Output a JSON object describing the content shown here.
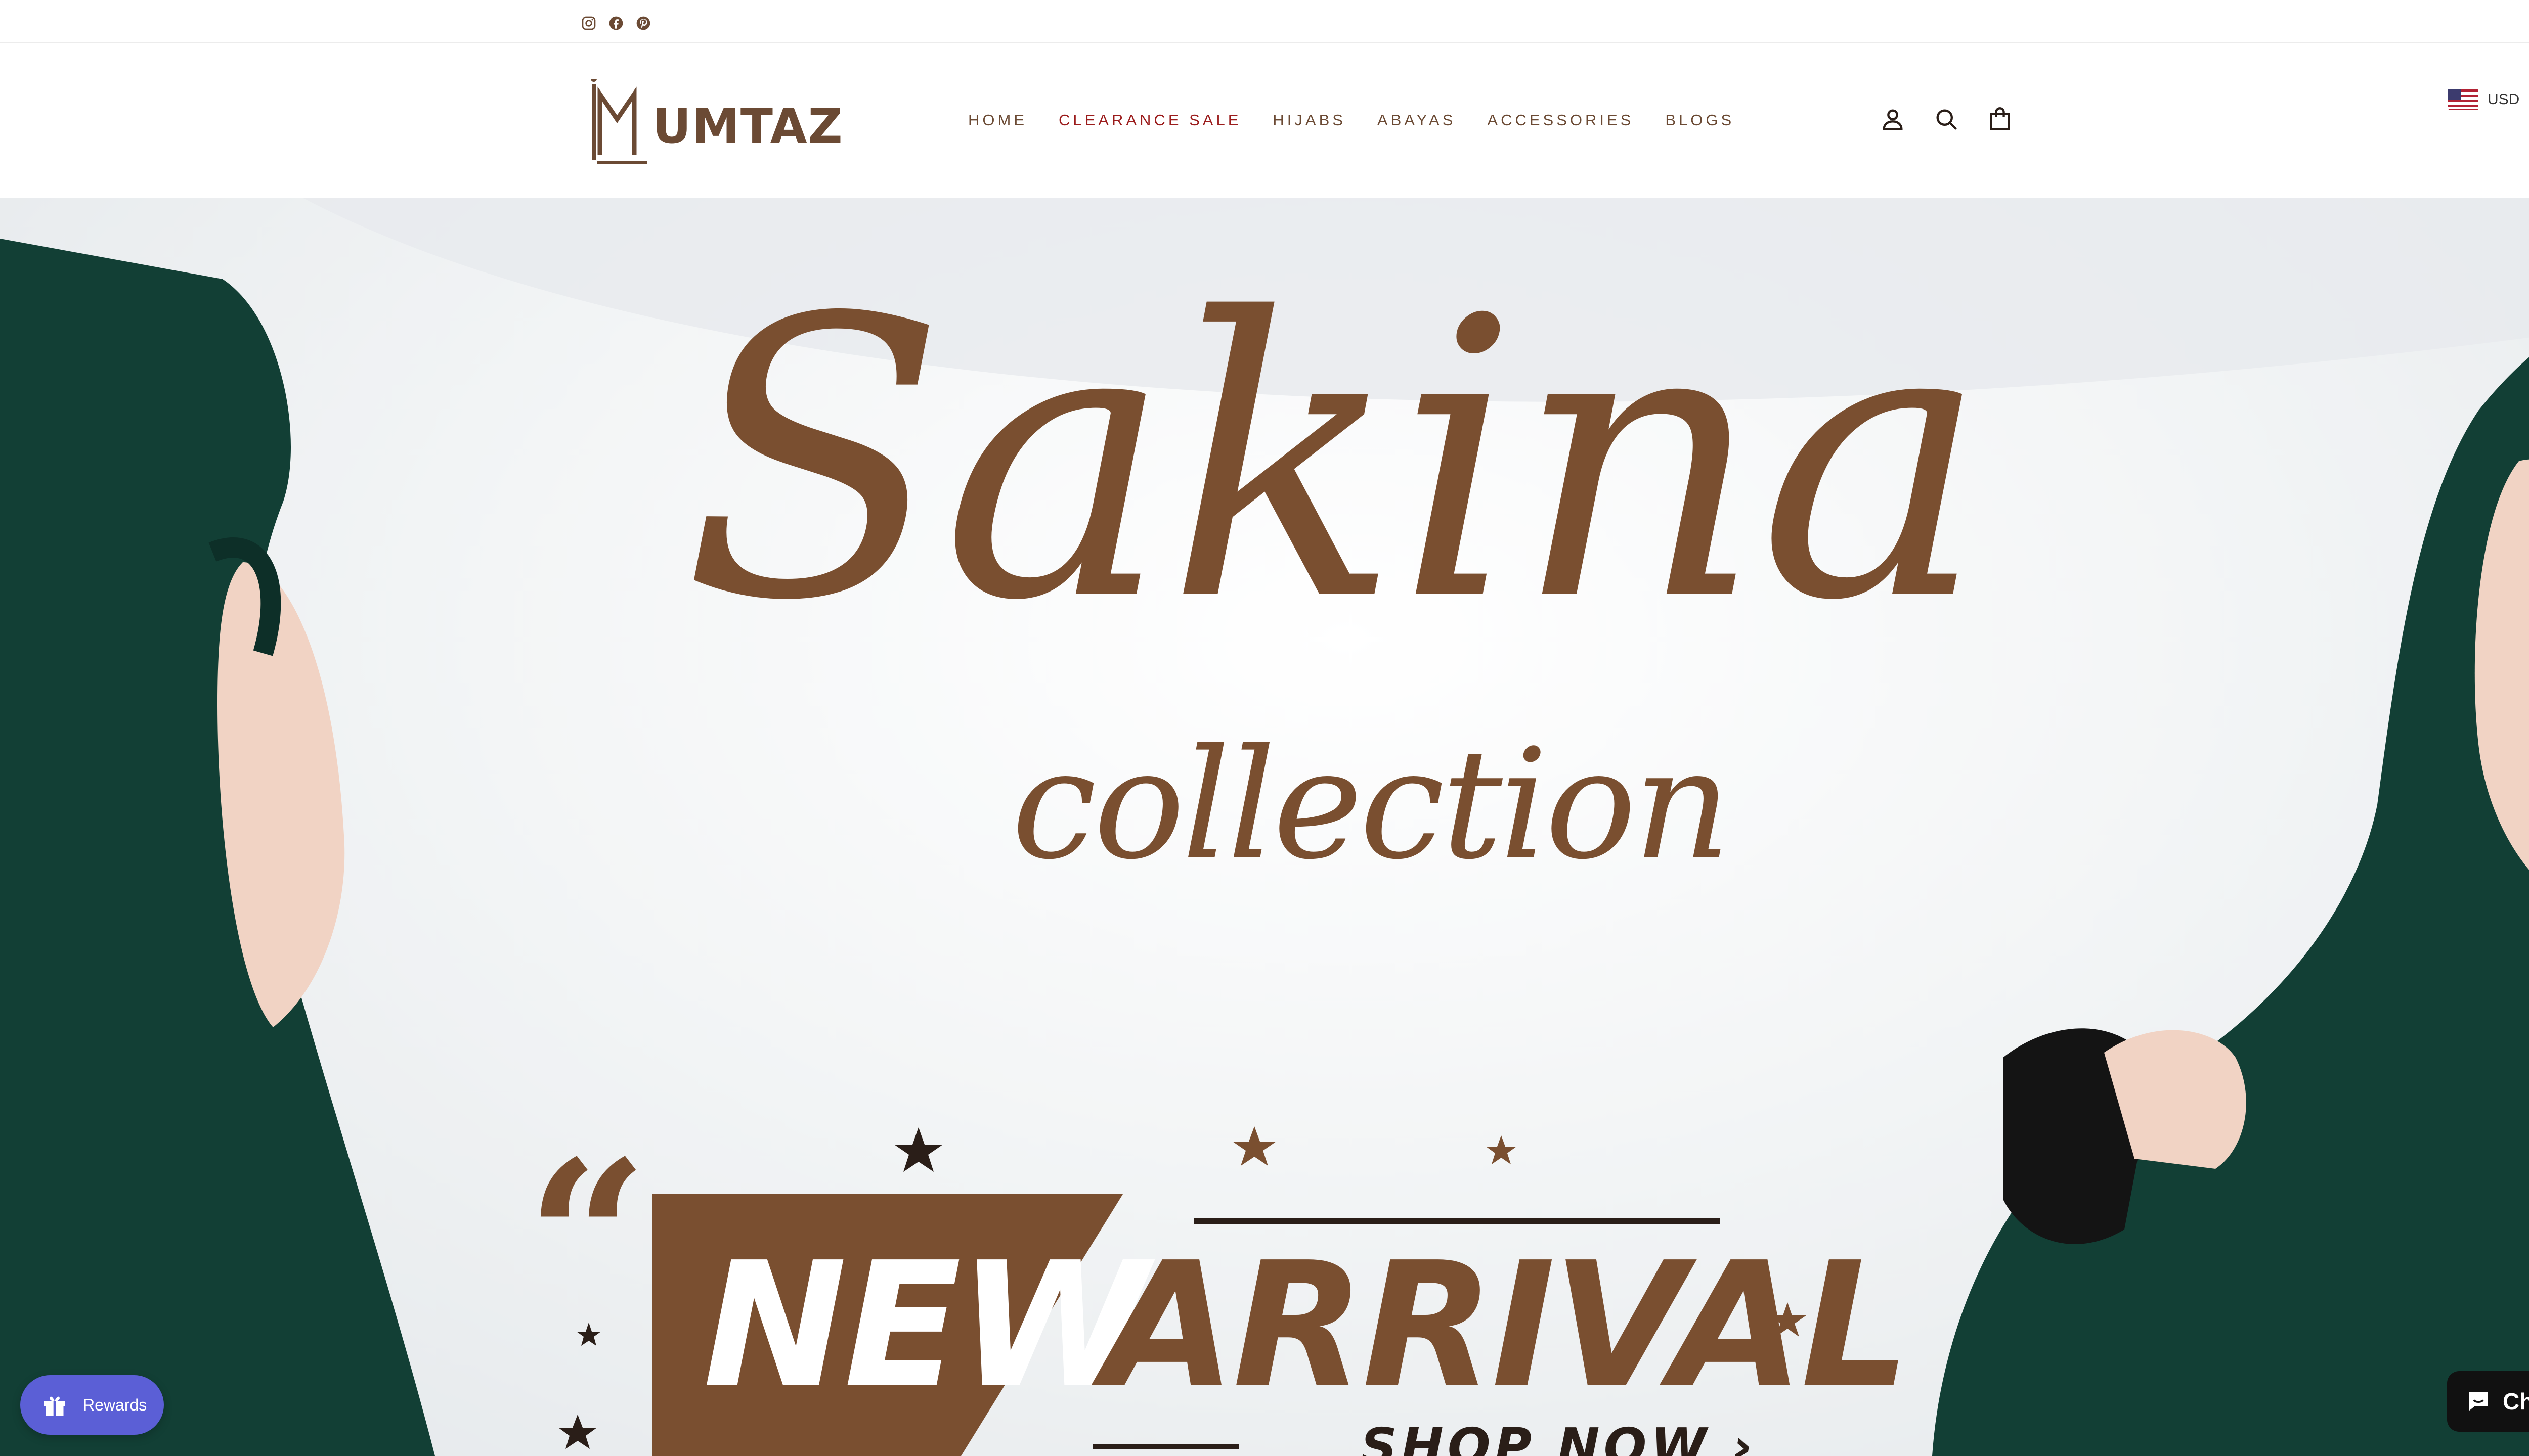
{
  "socials": {
    "instagram": "instagram-icon",
    "facebook": "facebook-icon",
    "pinterest": "pinterest-icon"
  },
  "brand": {
    "name": "UMTAZ",
    "color": "#6b4a34"
  },
  "nav": {
    "items": [
      {
        "label": "HOME"
      },
      {
        "label": "CLEARANCE SALE",
        "color": "#9b1c1c"
      },
      {
        "label": "HIJABS"
      },
      {
        "label": "ABAYAS"
      },
      {
        "label": "ACCESSORIES"
      },
      {
        "label": "BLOGS"
      }
    ]
  },
  "header_icons": {
    "account": "user-icon",
    "search": "search-icon",
    "cart": "cart-icon"
  },
  "currency": {
    "code": "USD",
    "flag": "us-flag-icon"
  },
  "hero": {
    "title": "Sakina",
    "subtitle": "collection",
    "quote": "“",
    "banner_word_1": "NEW",
    "banner_word_2": "ARRIVAL",
    "cta": "SHOP NOW ›",
    "accent": "#7a4f30",
    "garment_color": "#123f35"
  },
  "rewards": {
    "label": "Rewards",
    "color": "#5b5fd6"
  },
  "chat": {
    "label": "Chat"
  }
}
